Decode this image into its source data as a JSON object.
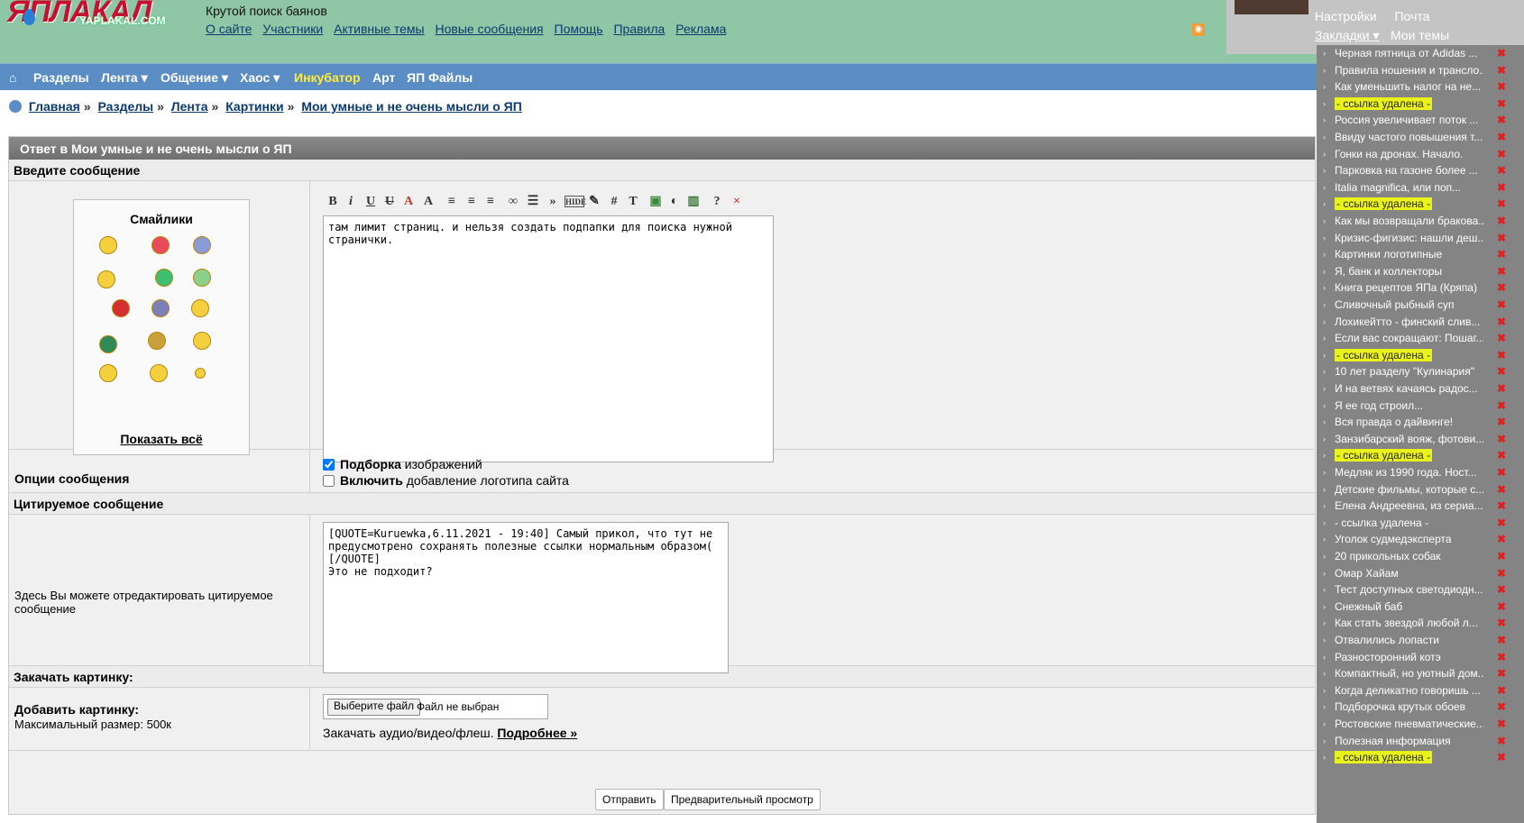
{
  "site": {
    "logo_text": "ЯПЛАКАЛ",
    "logo_sub": "YAPLAKAL.COM",
    "tagline": "Крутой поиск баянов"
  },
  "top_links": [
    "О сайте",
    "Участники",
    "Активные темы",
    "Новые сообщения",
    "Помощь",
    "Правила",
    "Реклама"
  ],
  "nav": {
    "home": "⌂",
    "items": [
      "Разделы",
      "Лента ▾",
      "Общение ▾",
      "Хаос ▾",
      "Инкубатор",
      "Арт",
      "ЯП Файлы"
    ]
  },
  "breadcrumb": [
    "Главная",
    "Разделы",
    "Лента",
    "Картинки",
    "Мои умные и не очень мысли о ЯП"
  ],
  "form": {
    "title": "Ответ в Мои умные и не очень мысли о ЯП",
    "enter_message": "Введите сообщение",
    "smileys_title": "Смайлики",
    "show_all": "Показать всё",
    "message_text": "там лимит страниц. и нельзя создать подпапки для поиска нужной странички.",
    "options_label": "Опции сообщения",
    "opt1_bold": "Подборка",
    "opt1_rest": " изображений",
    "opt2_bold": "Включить",
    "opt2_rest": " добавление логотипа сайта",
    "quoted_head": "Цитируемое сообщение",
    "quote_label": "Здесь Вы можете отредактировать цитируемое сообщение",
    "quote_text": "[QUOTE=Kuruewka,6.11.2021 - 19:40] Самый прикол, что тут не\nпредусмотрено сохранять полезные ссылки нормальным образом(\n[/QUOTE]\nЭто не подходит?",
    "upload_head": "Закачать картинку:",
    "add_image": "Добавить картинку:",
    "max_size": "Максимальный размер: 500к",
    "choose_file": "Выберите файл",
    "no_file": "Файл не выбран",
    "media_text": "Закачать аудио/видео/флеш.",
    "media_more": "Подробнее »",
    "send": "Отправить",
    "preview": "Предварительный просмотр"
  },
  "user_menu": {
    "settings": "Настройки",
    "mail": "Почта",
    "bookmarks": "Закладки ▾",
    "my_topics": "Мои темы"
  },
  "bookmarks": [
    {
      "text": "Черная пятница от Adidas ...",
      "deleted": false
    },
    {
      "text": "Правила ношения и трансло...",
      "deleted": false
    },
    {
      "text": "Как уменьшить налог на не...",
      "deleted": false
    },
    {
      "text": "- ссылка удалена -",
      "deleted": true
    },
    {
      "text": "Россия увеличивает поток ...",
      "deleted": false
    },
    {
      "text": "Ввиду частого повышения т...",
      "deleted": false
    },
    {
      "text": "Гонки на дронах. Начало.",
      "deleted": false
    },
    {
      "text": "Парковка на газоне более ...",
      "deleted": false
    },
    {
      "text": "Italia magnifica, или поп...",
      "deleted": false
    },
    {
      "text": "- ссылка удалена -",
      "deleted": true
    },
    {
      "text": "Как мы возвращали бракова...",
      "deleted": false
    },
    {
      "text": "Кризис-фигизис: нашли деш...",
      "deleted": false
    },
    {
      "text": "Картинки логотипные",
      "deleted": false
    },
    {
      "text": "Я, банк и коллекторы",
      "deleted": false
    },
    {
      "text": "Книга рецептов ЯПа (Кряпа)",
      "deleted": false
    },
    {
      "text": "Сливочный рыбный суп",
      "deleted": false
    },
    {
      "text": "Лохикейтто - финский слив...",
      "deleted": false
    },
    {
      "text": "Если вас сокращают: Пошаг...",
      "deleted": false
    },
    {
      "text": "- ссылка удалена -",
      "deleted": true
    },
    {
      "text": "10 лет разделу \"Кулинария\"",
      "deleted": false
    },
    {
      "text": "И на ветвях качаясь радос...",
      "deleted": false
    },
    {
      "text": "Я ее год строил...",
      "deleted": false
    },
    {
      "text": "Вся правда о дайвинге!",
      "deleted": false
    },
    {
      "text": "Занзибарский вояж, фотови...",
      "deleted": false
    },
    {
      "text": "- ссылка удалена -",
      "deleted": true
    },
    {
      "text": "Медляк из 1990 года. Ност...",
      "deleted": false
    },
    {
      "text": "Детские фильмы, которые с...",
      "deleted": false
    },
    {
      "text": "Елена Андреевна, из сериа...",
      "deleted": false
    },
    {
      "text": "- ссылка удалена -",
      "deleted": false
    },
    {
      "text": "Уголок судмедэксперта",
      "deleted": false
    },
    {
      "text": "20 прикольных собак",
      "deleted": false
    },
    {
      "text": "Омар Хайам",
      "deleted": false
    },
    {
      "text": "Тест доступных светодиодн...",
      "deleted": false
    },
    {
      "text": "Снежный баб",
      "deleted": false
    },
    {
      "text": "Как стать звездой любой л...",
      "deleted": false
    },
    {
      "text": "Отвалились лопасти",
      "deleted": false
    },
    {
      "text": "Разносторонний котэ",
      "deleted": false
    },
    {
      "text": "Компактный, но уютный дом...",
      "deleted": false
    },
    {
      "text": "Когда деликатно говоришь ...",
      "deleted": false
    },
    {
      "text": "Подборочка крутых обоев",
      "deleted": false
    },
    {
      "text": "Ростовские пневматические...",
      "deleted": false
    },
    {
      "text": "Полезная информация",
      "deleted": false
    },
    {
      "text": "- ссылка удалена -",
      "deleted": true
    }
  ],
  "colors": {
    "header": "#8ec6a6",
    "nav": "#5b8dc5",
    "highlight": "#e9f21a",
    "bookmark_bg": "#848484"
  }
}
